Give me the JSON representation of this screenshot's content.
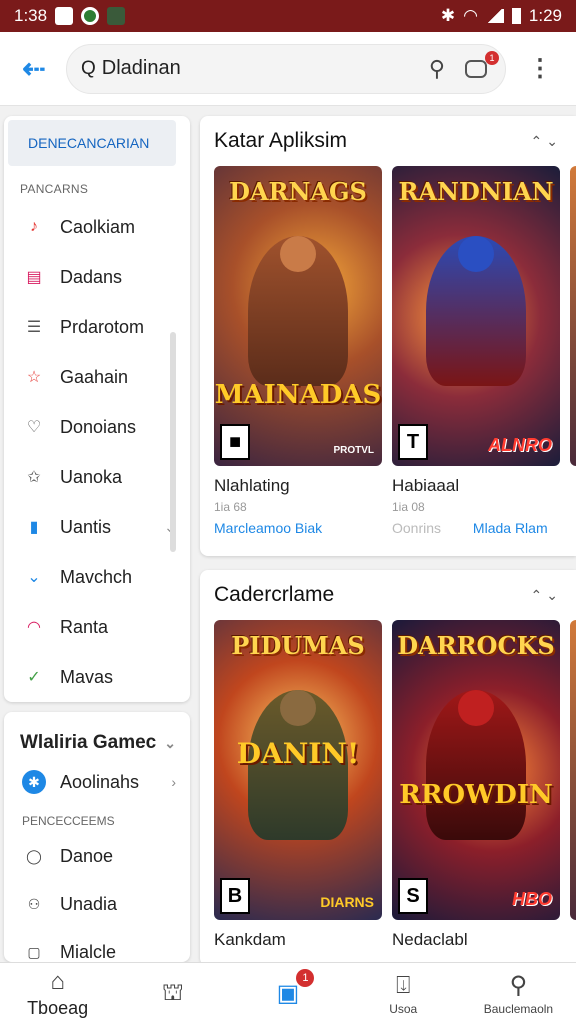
{
  "status": {
    "time_left": "1:38",
    "time_right": "1:29"
  },
  "appbar": {
    "search_value": "Dladinan",
    "badge": "1"
  },
  "sidebar": {
    "header": "DENECANCARIAN",
    "subheader": "PANCARNS",
    "items": [
      {
        "label": "Caolkiam",
        "icon": "music-icon",
        "color": "#e53935",
        "glyph": "♪"
      },
      {
        "label": "Dadans",
        "icon": "store-icon",
        "color": "#d81b60",
        "glyph": "▤"
      },
      {
        "label": "Prdarotom",
        "icon": "list-icon",
        "color": "#555555",
        "glyph": "☰"
      },
      {
        "label": "Gaahain",
        "icon": "star-icon",
        "color": "#e53935",
        "glyph": "☆"
      },
      {
        "label": "Donoians",
        "icon": "heart-icon",
        "color": "#555555",
        "glyph": "♡"
      },
      {
        "label": "Uanoka",
        "icon": "puzzle-icon",
        "color": "#555555",
        "glyph": "✩"
      },
      {
        "label": "Uantis",
        "icon": "chart-icon",
        "color": "#1e88e5",
        "glyph": "▮"
      },
      {
        "label": "Mavchch",
        "icon": "download-icon",
        "color": "#1e88e5",
        "glyph": "⌄"
      },
      {
        "label": "Ranta",
        "icon": "shape-icon",
        "color": "#d81b60",
        "glyph": "◠"
      },
      {
        "label": "Mavas",
        "icon": "check-icon",
        "color": "#43a047",
        "glyph": "✓"
      }
    ]
  },
  "sidebar2": {
    "title": "Wlaliria Gamec",
    "item1": "Aoolinahs",
    "sub": "PENCECCEEMS",
    "items": [
      {
        "label": "Danoe",
        "icon": "circle-icon",
        "glyph": "◯"
      },
      {
        "label": "Unadia",
        "icon": "person-icon",
        "glyph": "⚇"
      },
      {
        "label": "Mialcle",
        "icon": "box-icon",
        "glyph": "▢"
      }
    ]
  },
  "section1": {
    "title": "Katar Apliksim",
    "cards": [
      {
        "logo_top": "DARNAGS",
        "logo_bottom": "MAINADAS",
        "rating": "■",
        "pub": "PROTVL",
        "title": "Nlahlating",
        "meta": "1ia 68",
        "link": "Marcleamoo Biak"
      },
      {
        "logo_top": "RANDNIAN",
        "logo_bottom": "",
        "rating": "T",
        "pub": "ALNRO",
        "title": "Habiaaal",
        "meta": "1ia 08",
        "link": "Oonrins",
        "link2": "Mlada Rlam"
      }
    ]
  },
  "section2": {
    "title": "Cadercrlame",
    "cards": [
      {
        "logo_top": "PIDUMAS",
        "logo_bottom": "DANIN!",
        "rating": "B",
        "pub": "DIARNS",
        "title": "Kankdam",
        "meta": ""
      },
      {
        "logo_top": "DARROCKS",
        "logo_bottom": "RROWDIN",
        "rating": "S",
        "pub": "HBO",
        "title": "Nedaclabl",
        "meta": ""
      }
    ]
  },
  "bottomnav": [
    {
      "label": "Tboeag",
      "icon": "home-icon",
      "glyph": "⌂"
    },
    {
      "label": "",
      "icon": "book-icon",
      "glyph": "⛫"
    },
    {
      "label": "",
      "icon": "games-icon",
      "glyph": "▣",
      "badge": "1"
    },
    {
      "label": "Usoa",
      "icon": "updates-icon",
      "glyph": "⍗"
    },
    {
      "label": "Bauclemaoln",
      "icon": "account-icon",
      "glyph": "⚲"
    }
  ]
}
